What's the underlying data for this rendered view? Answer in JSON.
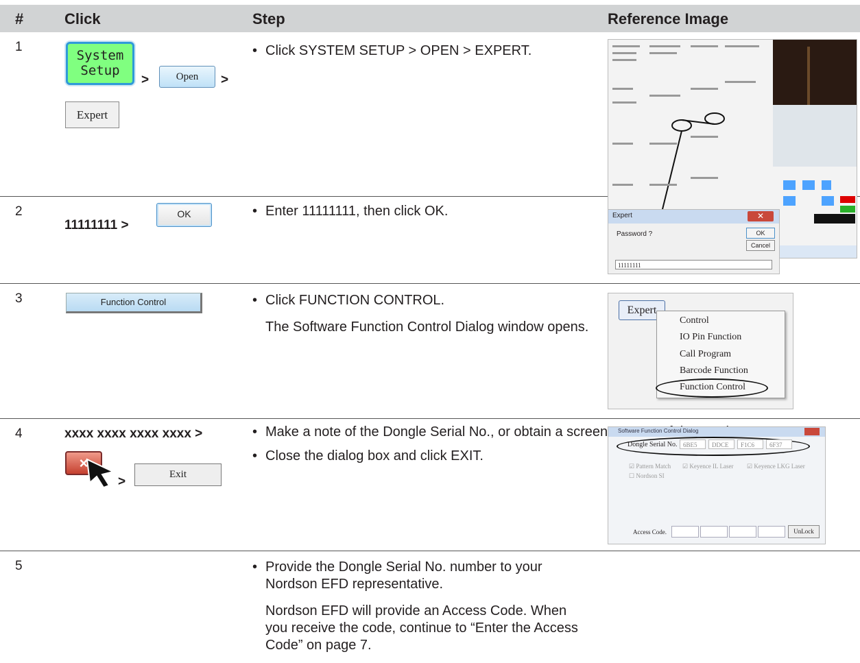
{
  "header": {
    "col_num": "#",
    "col_click": "Click",
    "col_step": "Step",
    "col_ref": "Reference Image"
  },
  "rows": [
    {
      "num": "1",
      "click": {
        "system_setup": "System Setup",
        "open": "Open",
        "expert": "Expert",
        "sep": ">"
      },
      "step": {
        "bullet": "Click SYSTEM SETUP > OPEN > EXPERT."
      }
    },
    {
      "num": "2",
      "click": {
        "code": "11111111 >",
        "ok": "OK"
      },
      "step": {
        "bullet": "Enter 11111111, then click OK."
      },
      "ref": {
        "title": "Expert",
        "prompt": "Password ?",
        "ok": "OK",
        "cancel": "Cancel",
        "value": "11111111"
      }
    },
    {
      "num": "3",
      "click": {
        "function_control": "Function Control"
      },
      "step": {
        "bullet": "Click FUNCTION CONTROL.",
        "para": "The Software Function Control Dialog window opens."
      },
      "ref": {
        "button": "Expert",
        "menu": [
          "Control",
          "IO Pin Function",
          "Call Program",
          "Barcode Function",
          "Function Control"
        ]
      }
    },
    {
      "num": "4",
      "click": {
        "serial": "xxxx xxxx xxxx xxxx >",
        "close": "×",
        "sep": ">",
        "exit": "Exit"
      },
      "step": {
        "bullet1": "Make a note of the Dongle Serial No., or obtain a screen capture of the number.",
        "bullet2": "Close the dialog box and click EXIT."
      },
      "ref": {
        "title": "Software Function Control Dialog",
        "serial_label": "Dongle Serial No.",
        "serial": [
          "6BE5",
          "DDCE",
          "F1C6",
          "6F37"
        ],
        "options": [
          "Pattern Match",
          "Keyence IL Laser",
          "Keyence LKG Laser",
          "Nordson SI"
        ],
        "access_label": "Access Code.",
        "unlock": "UnLock"
      }
    },
    {
      "num": "5",
      "step": {
        "bullet": "Provide the Dongle Serial No. number to your Nordson EFD representative.",
        "para": "Nordson EFD will provide an Access Code. When you receive the code, continue to “Enter the Access Code” on page 7."
      }
    }
  ],
  "colors": {
    "header_bg": "#d1d3d4",
    "green_button": "#80ff80",
    "accent_blue": "#2f9ad8"
  }
}
